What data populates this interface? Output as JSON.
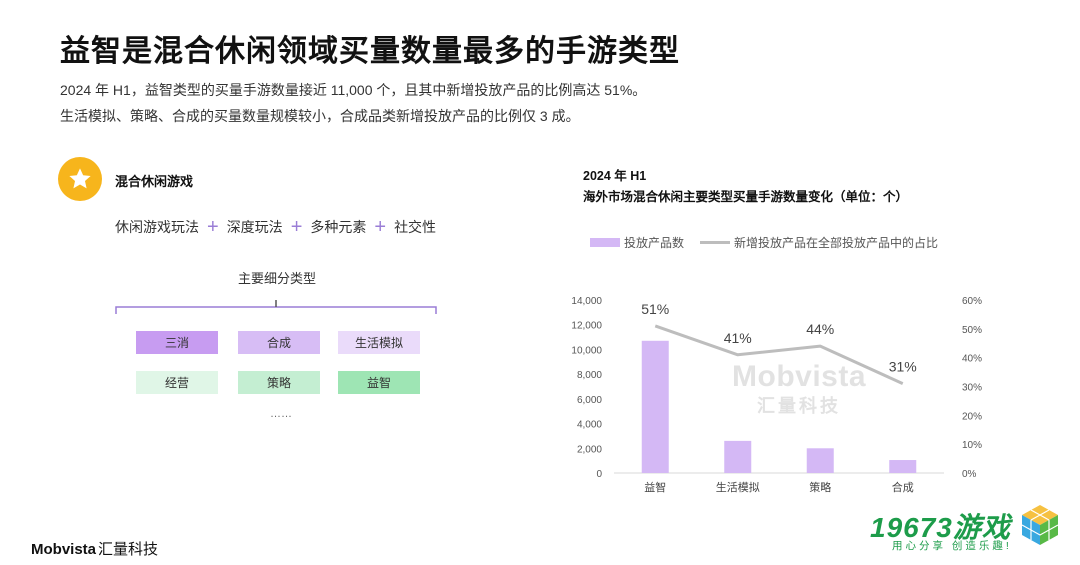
{
  "title": "益智是混合休闲领域买量数量最多的手游类型",
  "description": [
    "2024 年 H1，益智类型的买量手游数量接近 11,000 个，且其中新增投放产品的比例高达 51%。",
    "生活模拟、策略、合成的买量数量规模较小，合成品类新增投放产品的比例仅 3 成。"
  ],
  "category": {
    "icon": "star-icon",
    "title": "混合休闲游戏",
    "formula": [
      "休闲游戏玩法",
      "深度玩法",
      "多种元素",
      "社交性"
    ],
    "subtitle": "主要细分类型",
    "tags": [
      {
        "label": "三消",
        "bg": "#c79cf1"
      },
      {
        "label": "合成",
        "bg": "#d7bdf5"
      },
      {
        "label": "生活模拟",
        "bg": "#eadbfa"
      },
      {
        "label": "经营",
        "bg": "#e0f6e7"
      },
      {
        "label": "策略",
        "bg": "#c4eed2"
      },
      {
        "label": "益智",
        "bg": "#9ee5b4"
      }
    ],
    "more": "……"
  },
  "chart_data": {
    "type": "bar",
    "title_line1": "2024 年 H1",
    "title_line2": "海外市场混合休闲主要类型买量手游数量变化（单位：个）",
    "categories": [
      "益智",
      "生活模拟",
      "策略",
      "合成"
    ],
    "series": [
      {
        "name": "投放产品数",
        "type": "bar",
        "axis": "left",
        "color": "#d4b8f5",
        "values": [
          10700,
          2600,
          2000,
          1050
        ]
      },
      {
        "name": "新增投放产品在全部投放产品中的占比",
        "type": "line",
        "axis": "right",
        "color": "#bdbdbd",
        "values": [
          51,
          41,
          44,
          31
        ],
        "labels": [
          "51%",
          "41%",
          "44%",
          "31%"
        ]
      }
    ],
    "left_axis": {
      "min": 0,
      "max": 14000,
      "ticks": [
        "0",
        "2,000",
        "4,000",
        "6,000",
        "8,000",
        "10,000",
        "12,000",
        "14,000"
      ]
    },
    "right_axis": {
      "min": 0,
      "max": 60,
      "ticks": [
        "0%",
        "10%",
        "20%",
        "30%",
        "40%",
        "50%",
        "60%"
      ]
    }
  },
  "watermark": {
    "line1": "Mobvista",
    "line2": "汇量科技"
  },
  "brand": {
    "en": "Mobvista",
    "cn": "汇量科技"
  },
  "logo": {
    "main": "19673游戏",
    "sub": "用心分享 创造乐趣!"
  }
}
